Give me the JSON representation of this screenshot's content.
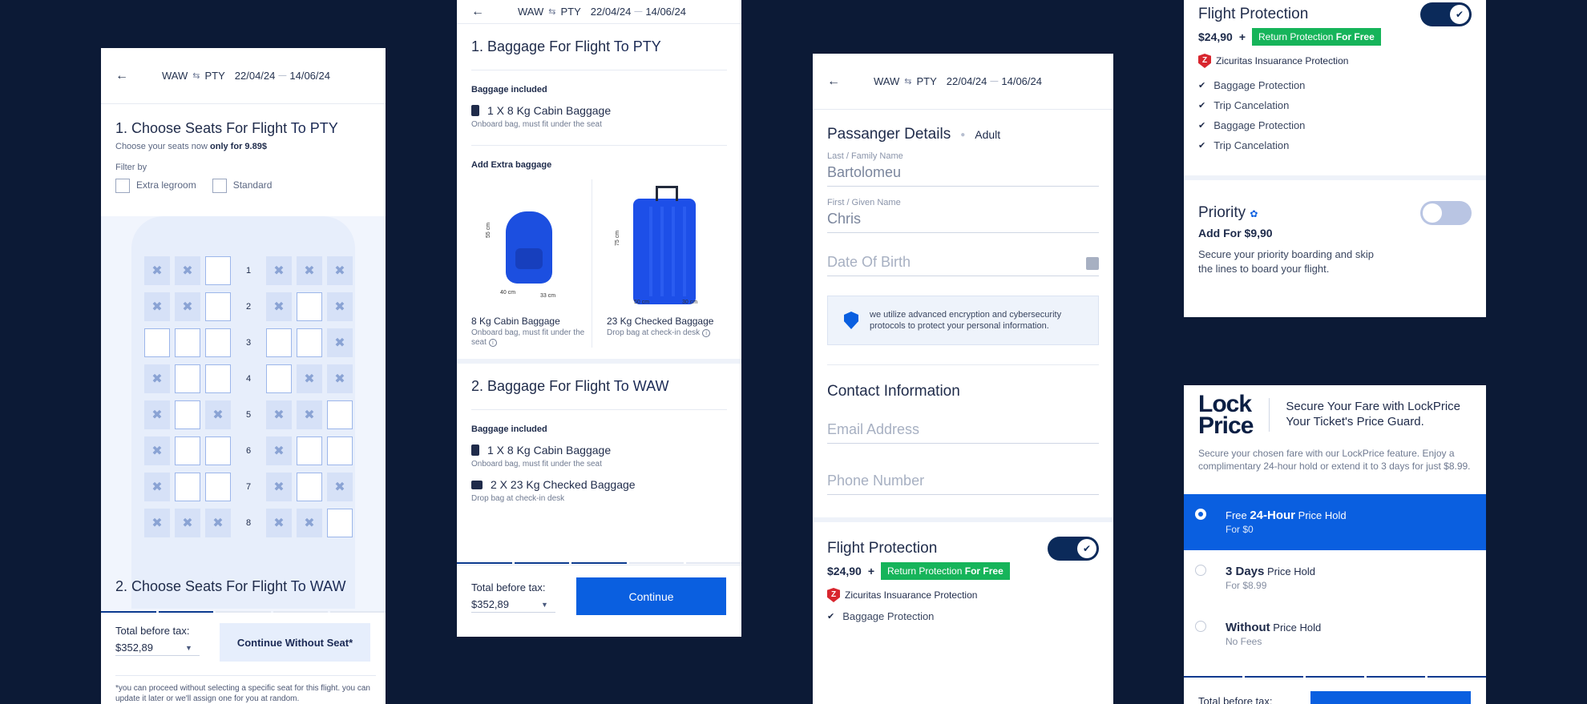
{
  "route": {
    "from": "WAW",
    "to": "PTY",
    "date_out": "22/04/24",
    "date_back": "14/06/24"
  },
  "seats": {
    "title_prefix": "1. Choose Seats For Flight ",
    "title_dest": "To PTY",
    "sub_prefix": "Choose your seats now ",
    "sub_bold": "only for 9.89$",
    "filter_label": "Filter by",
    "filters": [
      "Extra legroom",
      "Standard"
    ],
    "rows": [
      {
        "num": "1",
        "left": [
          "x",
          "x",
          "o"
        ],
        "right": [
          "x",
          "x",
          "x"
        ]
      },
      {
        "num": "2",
        "left": [
          "x",
          "x",
          "o"
        ],
        "right": [
          "x",
          "o",
          "x"
        ]
      },
      {
        "num": "3",
        "left": [
          "o",
          "o",
          "o"
        ],
        "right": [
          "o",
          "o",
          "x"
        ]
      },
      {
        "num": "4",
        "left": [
          "x",
          "o",
          "o"
        ],
        "right": [
          "o",
          "x",
          "x"
        ]
      },
      {
        "num": "5",
        "left": [
          "x",
          "o",
          "x"
        ],
        "right": [
          "x",
          "x",
          "o"
        ]
      },
      {
        "num": "6",
        "left": [
          "x",
          "o",
          "o"
        ],
        "right": [
          "x",
          "o",
          "o"
        ]
      },
      {
        "num": "7",
        "left": [
          "x",
          "o",
          "o"
        ],
        "right": [
          "x",
          "o",
          "x"
        ]
      },
      {
        "num": "8",
        "left": [
          "x",
          "x",
          "x"
        ],
        "right": [
          "x",
          "x",
          "o"
        ]
      }
    ],
    "next_prefix": "2. Choose Seats For Flight ",
    "next_dest": "To WAW",
    "total_label": "Total before tax:",
    "total_value": "$352,89",
    "continue_without": "Continue Without Seat*",
    "note": "*you can proceed without selecting a specific seat for this flight. you  can update it later or we'll assign one for you at random."
  },
  "baggage": {
    "title1_prefix": "1. Baggage For Flight ",
    "title1_dest": "To PTY",
    "included_label": "Baggage included",
    "cabin_item": "1 X 8 Kg Cabin Baggage",
    "cabin_sub": "Onboard bag, must fit under the seat",
    "extra_label": "Add Extra baggage",
    "extras": [
      {
        "name": "8 Kg Cabin Baggage",
        "sub": "Onboard bag, must fit under the seat",
        "dims": [
          "55 cm",
          "40 cm",
          "33 cm"
        ]
      },
      {
        "name": "23 Kg Checked Baggage",
        "sub": "Drop bag at check-in desk",
        "dims": [
          "75 cm",
          "50 cm",
          "30 cm"
        ]
      }
    ],
    "title2_prefix": "2. Baggage For Flight ",
    "title2_dest": "To WAW",
    "checked_item": "2 X 23 Kg Checked Baggage",
    "checked_sub": "Drop bag at check-in desk",
    "total_label": "Total before tax:",
    "total_value": "$352,89",
    "continue": "Continue"
  },
  "passenger": {
    "title": "Passanger Details",
    "type": "Adult",
    "last_label": "Last / Family Name",
    "last_value": "Bartolomeu",
    "first_label": "First / Given Name",
    "first_value": "Chris",
    "dob_placeholder": "Date Of Birth",
    "secure_text": "we utilize advanced encryption and cybersecurity protocols to protect your personal information.",
    "contact_title": "Contact Information",
    "email_placeholder": "Email Address",
    "phone_placeholder": "Phone Number"
  },
  "protection": {
    "title": "Flight Protection",
    "price": "$24,90",
    "plus": "+",
    "badge_a": "Return Protection ",
    "badge_b": "For Free",
    "insurer": "Zicuritas Insuarance Protection",
    "items": [
      "Baggage Protection",
      "Trip Cancelation",
      "Baggage Protection",
      "Trip Cancelation"
    ]
  },
  "priority": {
    "title": "Priority",
    "price": "Add For $9,90",
    "desc": "Secure your priority boarding and skip the lines to board your flight."
  },
  "lockprice": {
    "logo_a": "Lock",
    "logo_b": "Price",
    "headline": "Secure Your Fare with LockPrice Your Ticket's Price Guard.",
    "desc": "Secure your chosen fare with our LockPrice feature. Enjoy a complimentary 24-hour hold or extend it to 3 days for just $8.99.",
    "options": [
      {
        "pre": "Free ",
        "bold": "24-Hour",
        "post": " Price Hold",
        "sub": "For $0",
        "selected": true
      },
      {
        "pre": "",
        "bold": "3 Days",
        "post": " Price Hold",
        "sub": "For $8.99",
        "selected": false
      },
      {
        "pre": "",
        "bold": "Without",
        "post": " Price Hold",
        "sub": "No Fees",
        "selected": false
      }
    ],
    "total_label": "Total before tax:"
  },
  "colors": {
    "background": "#0c1a36",
    "primary": "#0a5fe0",
    "success": "#16b45a",
    "navy": "#0b2a5a"
  }
}
